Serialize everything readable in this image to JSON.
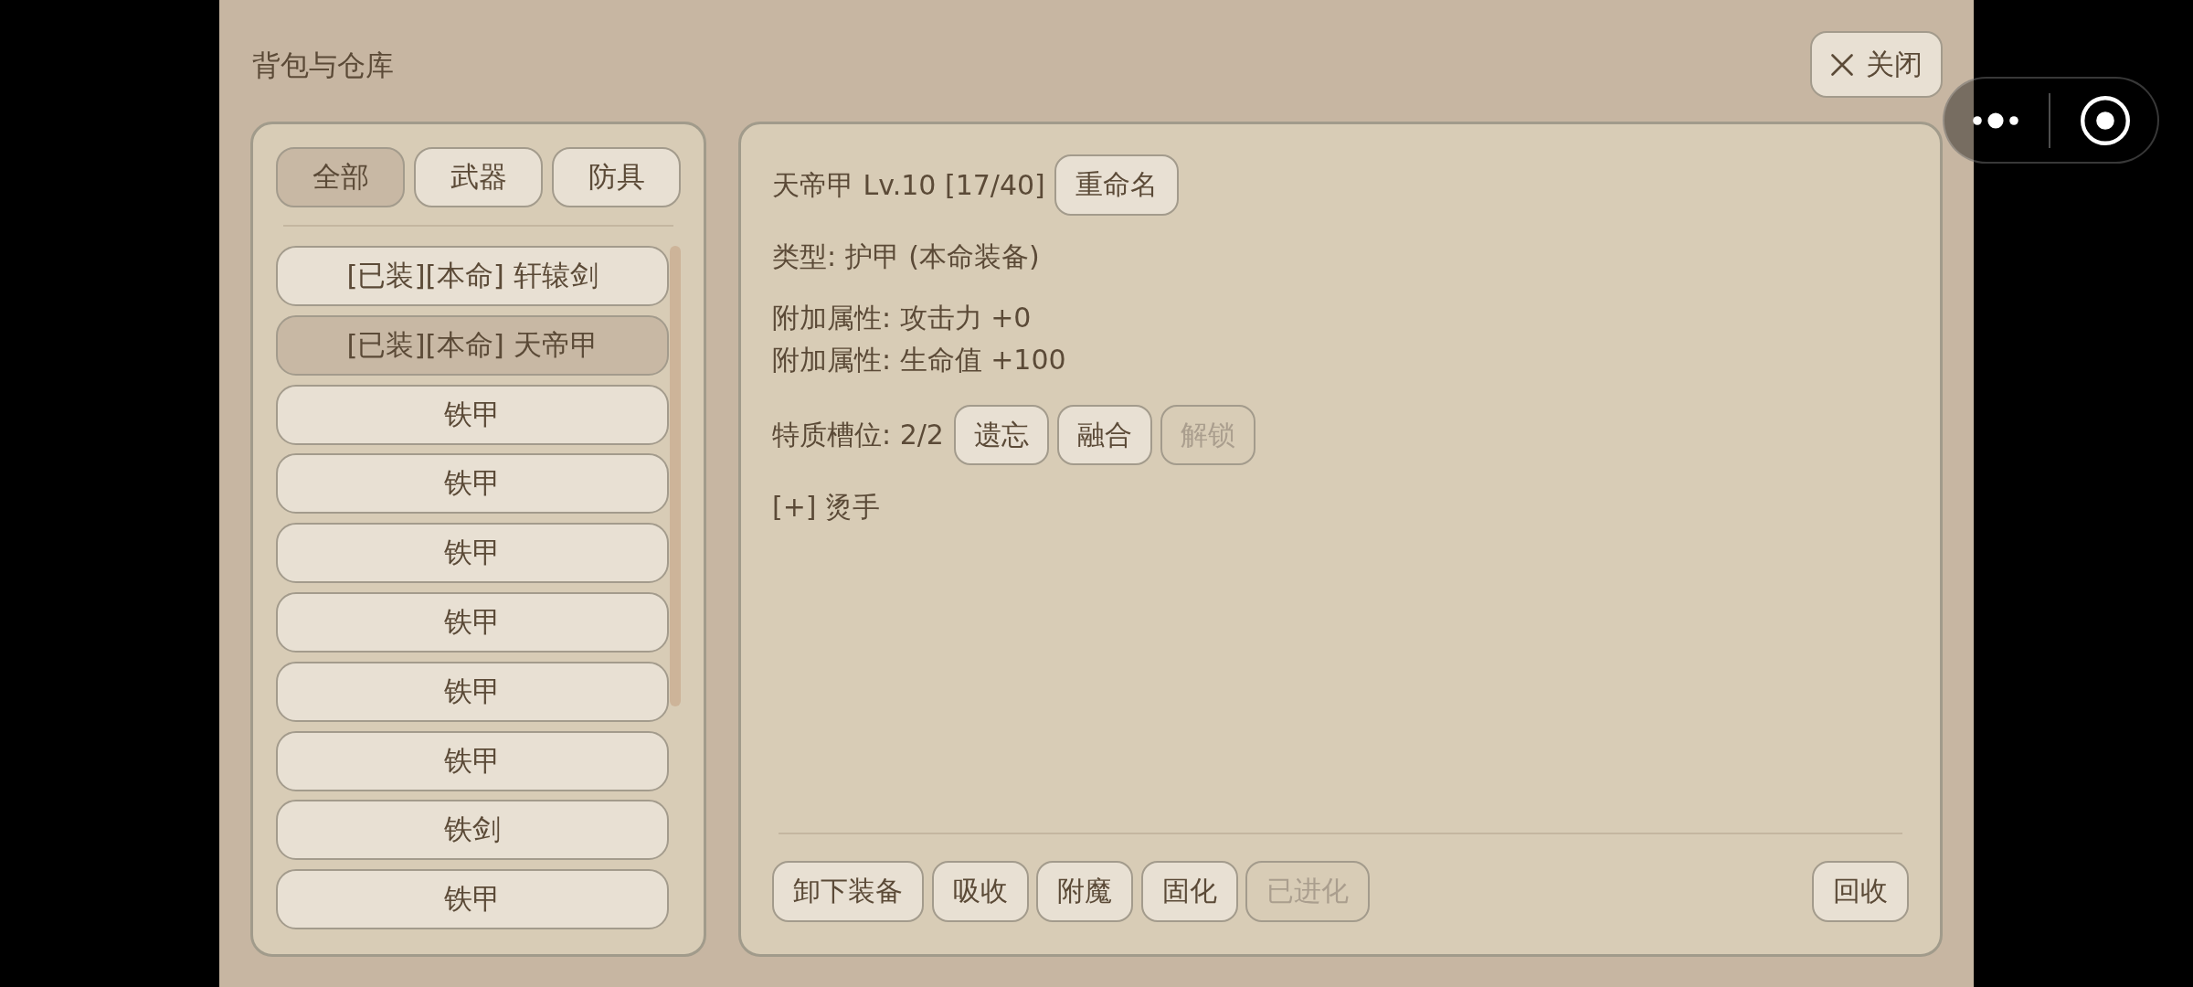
{
  "window": {
    "title": "背包与仓库",
    "close_button": "关闭"
  },
  "tabs": [
    {
      "label": "全部",
      "selected": true
    },
    {
      "label": "武器",
      "selected": false
    },
    {
      "label": "防具",
      "selected": false
    }
  ],
  "items": [
    {
      "label": "[已装][本命] 轩辕剑",
      "selected": false
    },
    {
      "label": "[已装][本命] 天帝甲",
      "selected": true
    },
    {
      "label": "铁甲",
      "selected": false
    },
    {
      "label": "铁甲",
      "selected": false
    },
    {
      "label": "铁甲",
      "selected": false
    },
    {
      "label": "铁甲",
      "selected": false
    },
    {
      "label": "铁甲",
      "selected": false
    },
    {
      "label": "铁甲",
      "selected": false
    },
    {
      "label": "铁剑",
      "selected": false
    },
    {
      "label": "铁甲",
      "selected": false
    }
  ],
  "detail": {
    "title": "天帝甲 Lv.10 [17/40]",
    "rename_button": "重命名",
    "type": "类型: 护甲 (本命装备)",
    "attributes": [
      "附加属性: 攻击力 +0",
      "附加属性: 生命值 +100"
    ],
    "trait_slots": {
      "label": "特质槽位: 2/2",
      "buttons": [
        {
          "label": "遗忘",
          "disabled": false
        },
        {
          "label": "融合",
          "disabled": false
        },
        {
          "label": "解锁",
          "disabled": true
        }
      ]
    },
    "traits": [
      "[+] 烫手"
    ],
    "actions": [
      {
        "label": "卸下装备",
        "disabled": false
      },
      {
        "label": "吸收",
        "disabled": false
      },
      {
        "label": "附魔",
        "disabled": false
      },
      {
        "label": "固化",
        "disabled": false
      },
      {
        "label": "已进化",
        "disabled": true
      }
    ],
    "recycle_button": "回收"
  }
}
